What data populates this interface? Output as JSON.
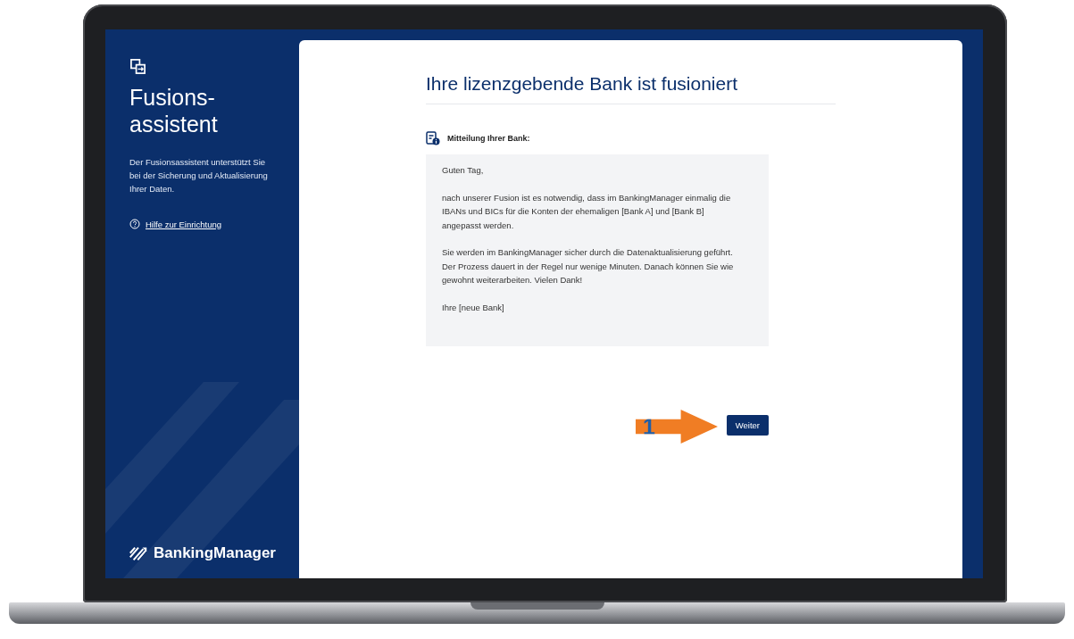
{
  "sidebar": {
    "title_lines": [
      "Fusions-",
      "assistent"
    ],
    "description": "Der Fusionsassistent unterstützt Sie bei der Sicherung und Aktualisierung Ihrer Daten.",
    "help_link": "Hilfe zur Einrichtung",
    "brand": "BankingManager"
  },
  "main": {
    "heading": "Ihre lizenzgebende Bank ist fusioniert",
    "message_label": "Mitteilung Ihrer Bank:",
    "message_paragraphs": [
      "Guten Tag,",
      "nach unserer Fusion ist es notwendig, dass im BankingManager einmalig die IBANs und BICs für die Konten der ehemaligen [Bank A] und [Bank B] angepasst werden.",
      "Sie werden im BankingManager sicher durch die Datenaktualisierung geführt. Der Prozess dauert in der Regel nur wenige Minuten. Danach können Sie wie gewohnt weiterarbeiten. Vielen Dank!",
      "Ihre [neue Bank]"
    ],
    "button": "Weiter"
  },
  "annotation": {
    "number": "1"
  }
}
